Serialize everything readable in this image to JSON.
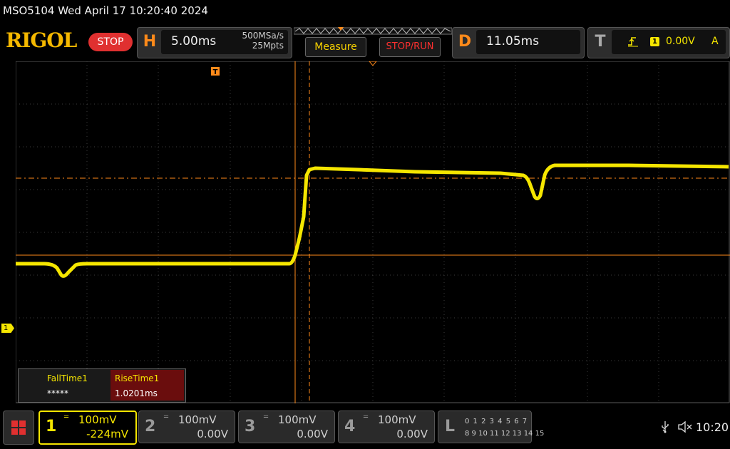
{
  "header": {
    "model_datetime": "MSO5104  Wed April 17 10:20:40 2024",
    "logo": "RIGOL",
    "run_state": "STOP"
  },
  "horizontal": {
    "letter": "H",
    "time_scale": "5.00ms",
    "sample_rate": "500MSa/s",
    "memory_depth": "25Mpts"
  },
  "buttons": {
    "measure": "Measure",
    "stop_run": "STOP/RUN"
  },
  "delay": {
    "letter": "D",
    "value": "11.05ms"
  },
  "trigger": {
    "letter": "T",
    "source": "1",
    "level": "0.00V",
    "mode": "A",
    "edge_icon": "rising-edge-icon"
  },
  "measurements": [
    {
      "name": "FallTime1",
      "value": "*****"
    },
    {
      "name": "RiseTime1",
      "value": "1.0201ms"
    }
  ],
  "channel_marker": "1",
  "channels": [
    {
      "num": "1",
      "scale": "100mV",
      "offset": "-224mV",
      "active": true,
      "color": "#f5e600"
    },
    {
      "num": "2",
      "scale": "100mV",
      "offset": "0.00V",
      "active": false,
      "color": "#9a9a9a"
    },
    {
      "num": "3",
      "scale": "100mV",
      "offset": "0.00V",
      "active": false,
      "color": "#9a9a9a"
    },
    {
      "num": "4",
      "scale": "100mV",
      "offset": "0.00V",
      "active": false,
      "color": "#9a9a9a"
    }
  ],
  "logic": {
    "letter": "L",
    "row1": "0 1 2 3   4 5 6 7",
    "row2": "8 9 10 11 12 13 14 15"
  },
  "status": {
    "clock": "10:20"
  },
  "colors": {
    "trace": "#f5e600",
    "cursor": "#ff8a1a",
    "grid": "#4a4a4a"
  }
}
